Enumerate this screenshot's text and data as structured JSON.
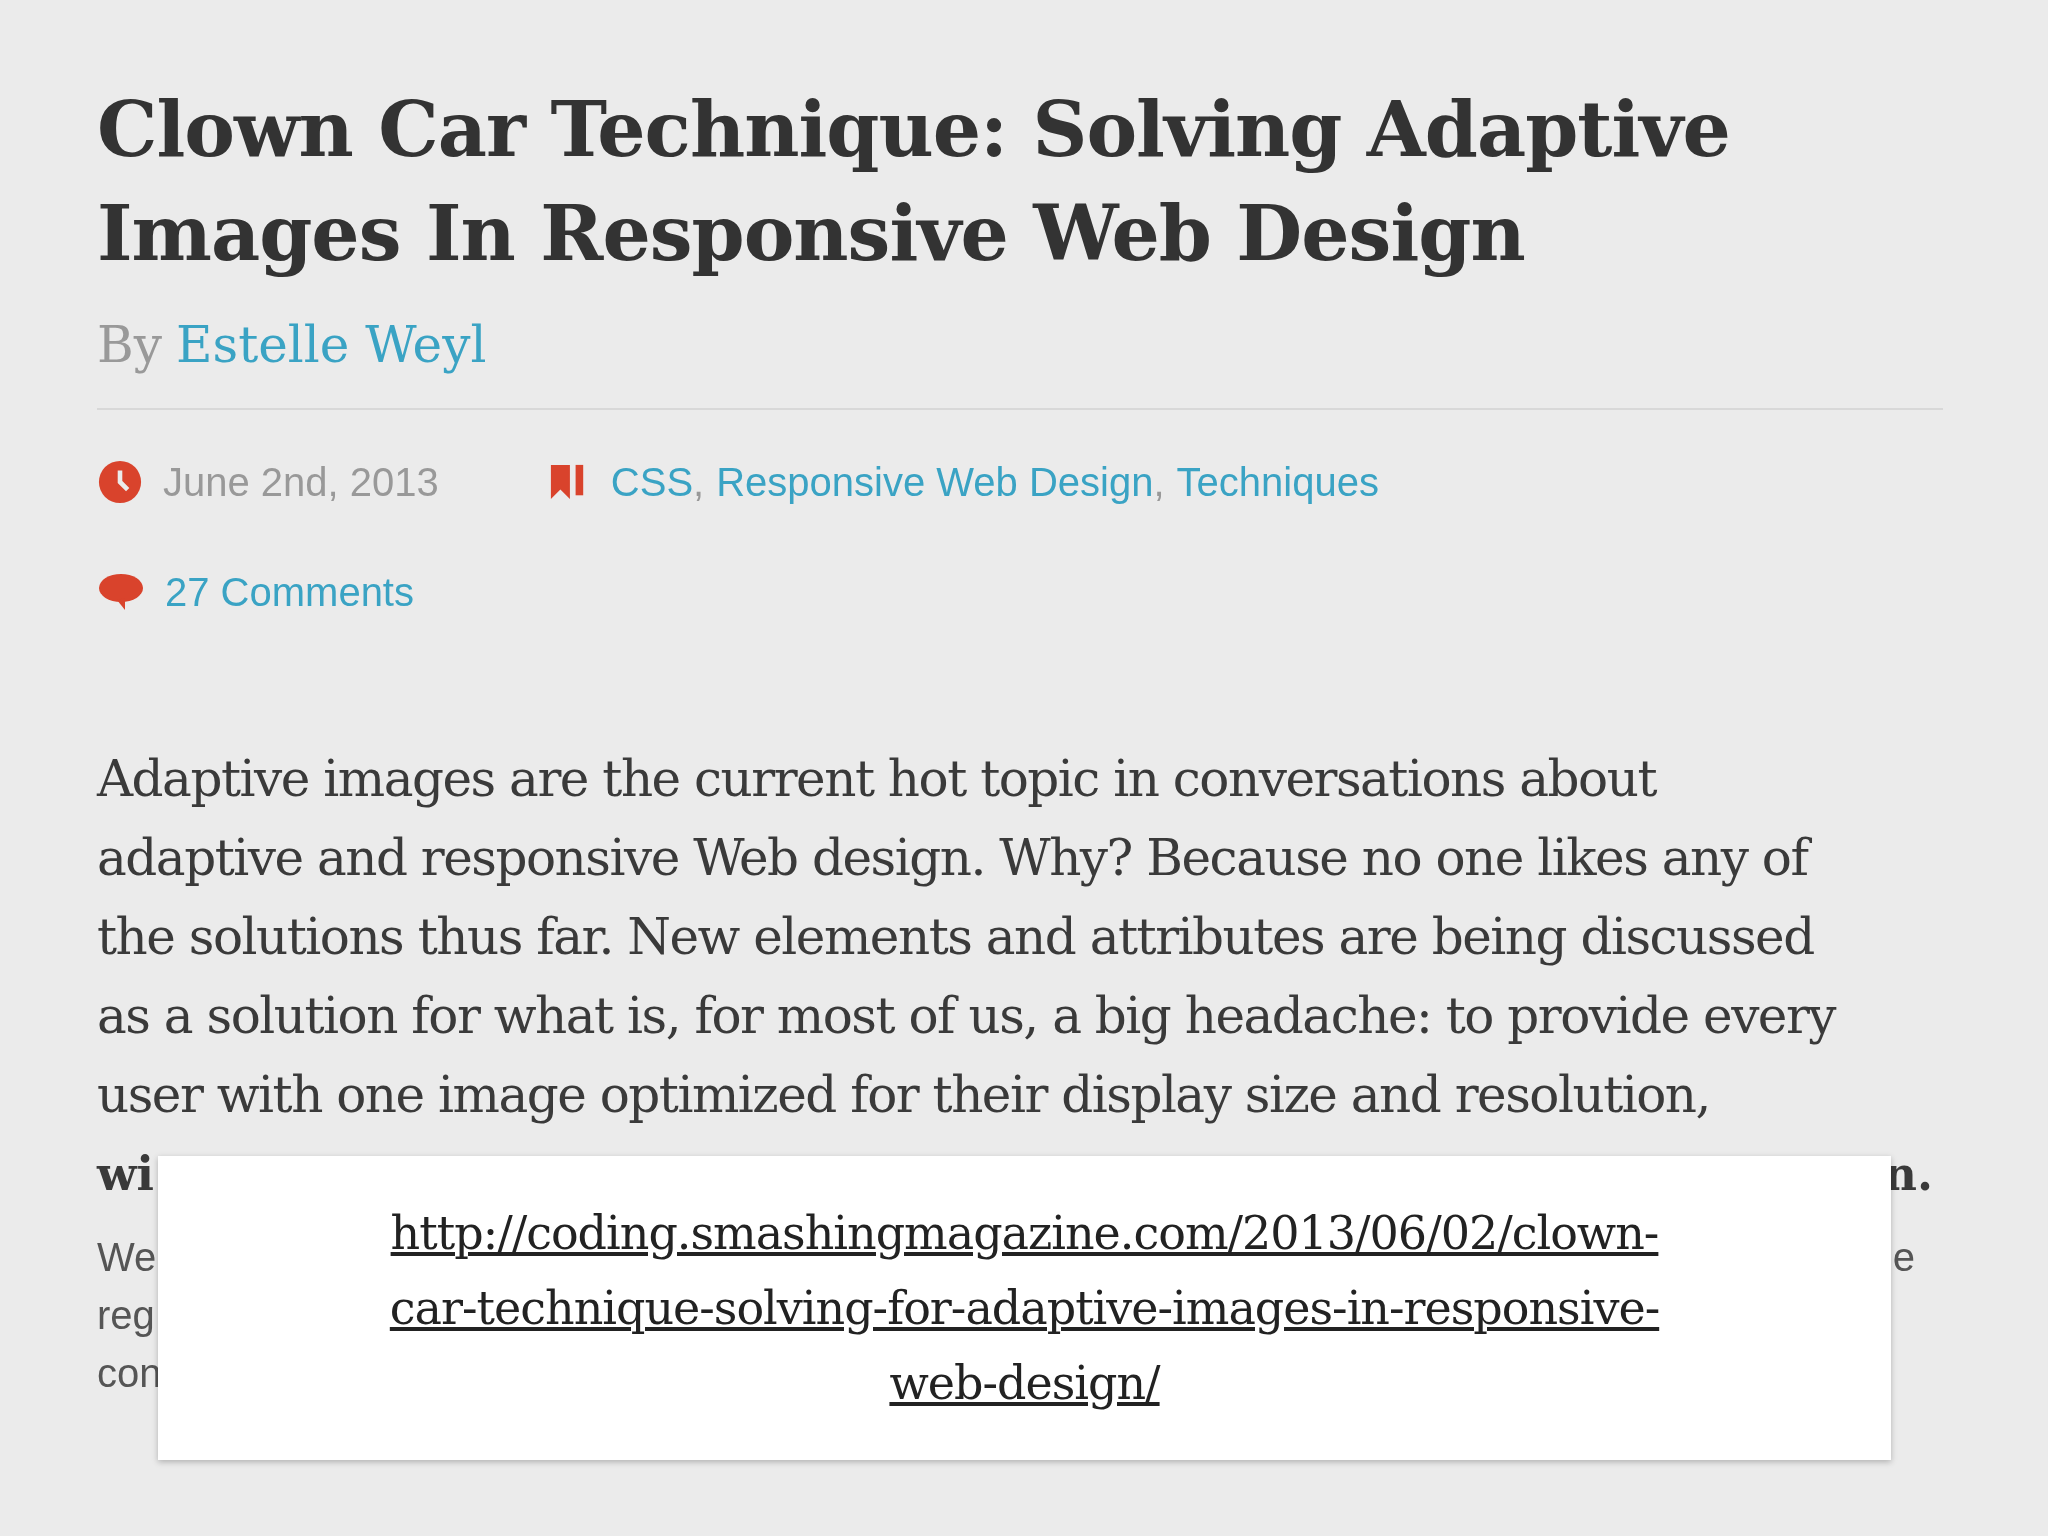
{
  "article": {
    "title_lines": [
      "Clown Car Technique: Solving Adaptive",
      "Images In Responsive Web Design"
    ],
    "byline": {
      "prefix": "By",
      "author": "Estelle Weyl"
    },
    "date": "June 2nd, 2013",
    "categories": [
      "CSS",
      "Responsive Web Design",
      "Techniques"
    ],
    "category_separator": ",",
    "comments": "27 Comments",
    "paragraph_lines": [
      "Adaptive images are the current hot topic in conversations about",
      "adaptive and responsive Web design. Why? Because no one likes any of",
      "the solutions thus far. New elements and attributes are being discussed",
      "as a solution for what is, for most of us, a big headache: to provide every",
      "user with one image optimized for their display size and resolution,"
    ],
    "hidden_line": {
      "start": "wi",
      "end": "n."
    },
    "second_paragraph": [
      {
        "start": "We",
        "end": "e"
      },
      {
        "start": "reg"
      },
      {
        "start": "con"
      }
    ]
  },
  "link_box": {
    "url_lines": [
      "http://coding.smashingmagazine.com/2013/06/02/clown-",
      "car-technique-solving-for-adaptive-images-in-responsive-",
      "web-design/"
    ]
  }
}
